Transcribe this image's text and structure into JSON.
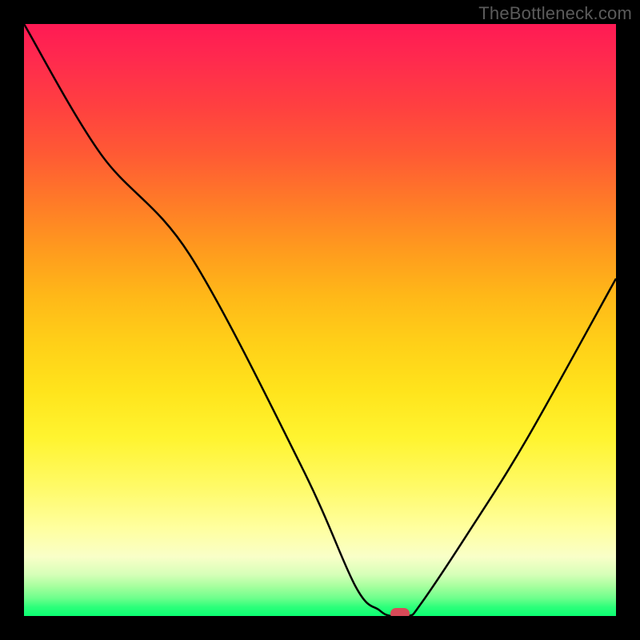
{
  "watermark": "TheBottleneck.com",
  "chart_data": {
    "type": "line",
    "title": "",
    "xlabel": "",
    "ylabel": "",
    "xlim": [
      0,
      100
    ],
    "ylim": [
      0,
      100
    ],
    "grid": false,
    "series": [
      {
        "name": "bottleneck-curve",
        "x": [
          0,
          13,
          28,
          47,
          56,
          60,
          62,
          65,
          67,
          75,
          85,
          100
        ],
        "values": [
          100,
          78,
          61,
          25,
          5,
          1,
          0,
          0,
          2,
          14,
          30,
          57
        ]
      }
    ],
    "marker": {
      "x": 63.5,
      "y": 0
    },
    "background_gradient": {
      "top": "#ff1a54",
      "mid": "#ffe41c",
      "bottom": "#0bff72"
    },
    "colors": {
      "curve": "#000000",
      "marker": "#d84a58",
      "frame": "#000000"
    }
  }
}
